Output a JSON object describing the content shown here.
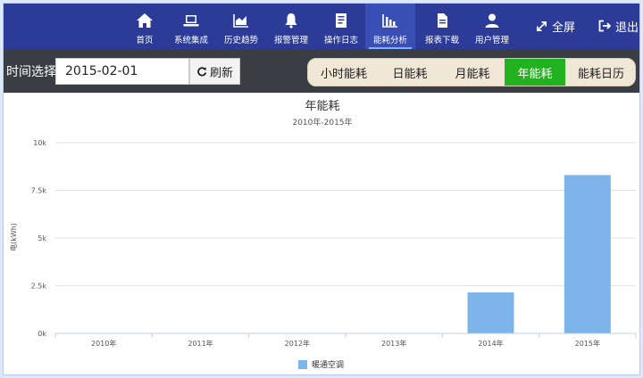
{
  "nav": {
    "items": [
      {
        "label": "首页",
        "icon": "home-icon"
      },
      {
        "label": "系统集成",
        "icon": "laptop-icon"
      },
      {
        "label": "历史趋势",
        "icon": "area-chart-icon"
      },
      {
        "label": "报警管理",
        "icon": "bell-icon"
      },
      {
        "label": "操作日志",
        "icon": "logbook-icon"
      },
      {
        "label": "能耗分析",
        "icon": "bar-chart-icon"
      },
      {
        "label": "报表下载",
        "icon": "document-icon"
      },
      {
        "label": "用户管理",
        "icon": "user-icon"
      }
    ],
    "active": "能耗分析",
    "fullscreen_label": "全屏",
    "logout_label": "退出"
  },
  "toolbar": {
    "time_label": "时间选择:",
    "date_value": "2015-02-01",
    "refresh_label": "刷新",
    "tabs": [
      "小时能耗",
      "日能耗",
      "月能耗",
      "年能耗",
      "能耗日历"
    ],
    "active_tab": "年能耗"
  },
  "colors": {
    "nav_bg": "#2b3b97",
    "toolbar_bg": "#3a3d44",
    "active_tab": "#23b21f",
    "bar": "#7db4ea"
  },
  "chart_data": {
    "type": "bar",
    "title": "年能耗",
    "subtitle": "2010年-2015年",
    "ylabel": "电(kWh)",
    "categories": [
      "2010年",
      "2011年",
      "2012年",
      "2013年",
      "2014年",
      "2015年"
    ],
    "series": [
      {
        "name": "暖通空调",
        "values": [
          0,
          0,
          0,
          0,
          2150,
          8300
        ]
      }
    ],
    "ylim": [
      0,
      10000
    ],
    "yticks": [
      0,
      2500,
      5000,
      7500,
      10000
    ],
    "ytick_labels": [
      "0k",
      "2.5k",
      "5k",
      "7.5k",
      "10k"
    ],
    "grid": true,
    "legend": "bottom-center"
  }
}
